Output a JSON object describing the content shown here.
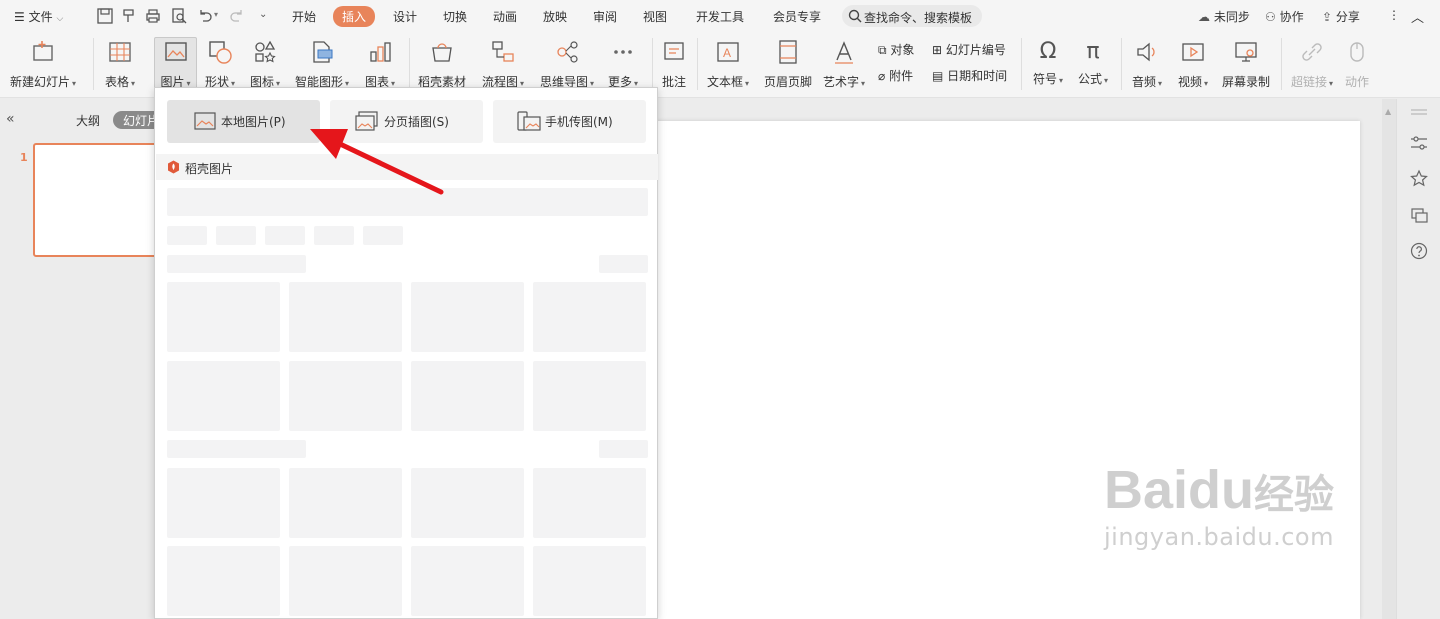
{
  "menubar": {
    "file_label": "文件",
    "tabs": [
      "开始",
      "插入",
      "设计",
      "切换",
      "动画",
      "放映",
      "审阅",
      "视图",
      "开发工具",
      "会员专享"
    ],
    "active_tab": "插入",
    "search_placeholder": "查找命令、搜索模板",
    "right": {
      "sync_label": "未同步",
      "collab_label": "协作",
      "share_label": "分享"
    }
  },
  "ribbon": {
    "new_slide": "新建幻灯片",
    "table": "表格",
    "picture": "图片",
    "shape": "形状",
    "icon": "图标",
    "smartart": "智能图形",
    "chart": "图表",
    "daoke_assets": "稻壳素材",
    "flowchart": "流程图",
    "mindmap": "思维导图",
    "more": "更多",
    "comment": "批注",
    "textbox": "文本框",
    "header_footer": "页眉页脚",
    "wordart": "艺术字",
    "object": "对象",
    "attachment": "附件",
    "slide_number": "幻灯片编号",
    "date_time": "日期和时间",
    "symbol": "符号",
    "formula": "公式",
    "audio": "音频",
    "video": "视频",
    "screen_record": "屏幕录制",
    "hyperlink": "超链接",
    "action": "动作"
  },
  "leftpanel": {
    "outline_tab": "大纲",
    "slides_tab": "幻灯片",
    "slide_number": "1"
  },
  "dropdown": {
    "local_picture": "本地图片(P)",
    "paged_picture": "分页插图(S)",
    "phone_picture": "手机传图(M)",
    "section_title": "稻壳图片"
  },
  "watermark": {
    "brand": "Baidu",
    "cn": "经验",
    "url": "jingyan.baidu.com"
  },
  "colors": {
    "accent": "#e8845a",
    "arrow": "#e5161b"
  }
}
